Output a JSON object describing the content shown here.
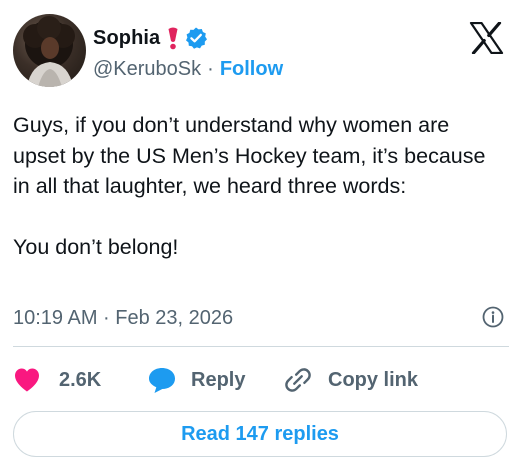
{
  "author": {
    "display_name": "Sophia",
    "name_emoji": "heavy-exclamation-mark-icon",
    "verified": true,
    "handle": "@KeruboSk",
    "separator": "·",
    "follow_label": "Follow"
  },
  "tweet": {
    "text": "Guys, if you don’t understand why women are upset by the US Men’s Hockey team, it’s because in all that laughter, we heard three words:\n\nYou don’t belong!",
    "timestamp": "10:19 AM · Feb 23, 2026"
  },
  "actions": {
    "likes": "2.6K",
    "reply_label": "Reply",
    "copy_link_label": "Copy link"
  },
  "read_replies_label": "Read 147 replies",
  "colors": {
    "accent": "#1d9bf0",
    "like": "#f91880",
    "text": "#0f1419",
    "secondary": "#536471",
    "border": "#cfd9de"
  }
}
